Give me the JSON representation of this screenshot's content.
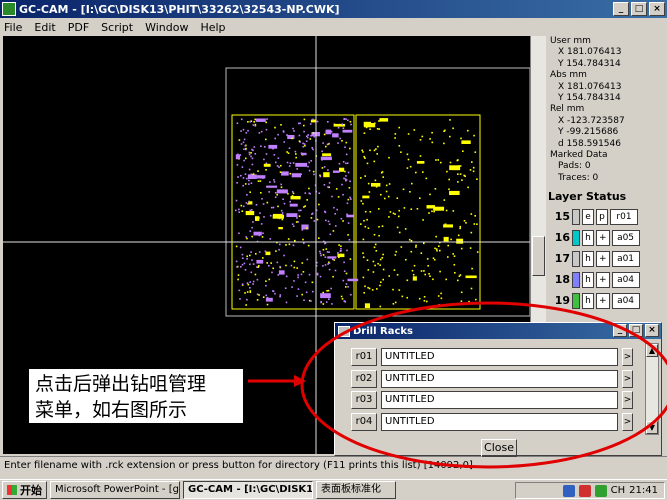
{
  "window": {
    "title": "GC-CAM - [I:\\GC\\DISK13\\PHIT\\33262\\32543-NP.CWK]"
  },
  "menu": [
    "File",
    "Edit",
    "PDF",
    "Script",
    "Window",
    "Help"
  ],
  "readout": {
    "user_label": "User mm",
    "user_x": "X 181.076413",
    "user_y": "Y 154.784314",
    "abs_label": "Abs mm",
    "abs_x": "X 181.076413",
    "abs_y": "Y 154.784314",
    "rel_label": "Rel mm",
    "rel_x": "X -123.723587",
    "rel_y": "Y -99.215686",
    "rel_d": "d 158.591546",
    "marked_label": "Marked Data",
    "pads": "Pads: 0",
    "traces": "Traces: 0"
  },
  "layer_status": {
    "title": "Layer Status",
    "layers": [
      {
        "num": "15",
        "color": "#c8c8c8",
        "a": "e",
        "b": "p",
        "name": "r01"
      },
      {
        "num": "16",
        "color": "#00c8c8",
        "a": "h",
        "b": "+",
        "name": "a05"
      },
      {
        "num": "17",
        "color": "#c8c8c8",
        "a": "h",
        "b": "+",
        "name": "a01"
      },
      {
        "num": "18",
        "color": "#8080ff",
        "a": "h",
        "b": "+",
        "name": "a04"
      },
      {
        "num": "19",
        "color": "#40c040",
        "a": "h",
        "b": "+",
        "name": "a04"
      }
    ]
  },
  "status_bar": {
    "text": "Enter filename with .rck extension or press button for directory (F11 prints this list) [14092,0]"
  },
  "dialog": {
    "title": "Drill Racks",
    "racks": [
      {
        "id": "r01",
        "name": "UNTITLED"
      },
      {
        "id": "r02",
        "name": "UNTITLED"
      },
      {
        "id": "r03",
        "name": "UNTITLED"
      },
      {
        "id": "r04",
        "name": "UNTITLED"
      }
    ],
    "close_label": "Close"
  },
  "annotation": {
    "line1": "点击后弹出钻咀管理",
    "line2": "菜单，如右图所示"
  },
  "taskbar": {
    "start_label": "开始",
    "tasks": [
      {
        "label": "Microsoft PowerPoint - [g...",
        "active": false
      },
      {
        "label": "GC-CAM - [I:\\GC\\DISK13\\...",
        "active": true
      },
      {
        "label": "表面板标准化",
        "active": false
      }
    ],
    "tray_lang": "CH",
    "clock": "21:41"
  },
  "colors": {
    "title_bar": "#0a246a",
    "canvas_bg": "#000000",
    "pad_yellow": "#ffff00",
    "pad_magenta": "#c080ff",
    "annotation_ring": "#e00000"
  }
}
